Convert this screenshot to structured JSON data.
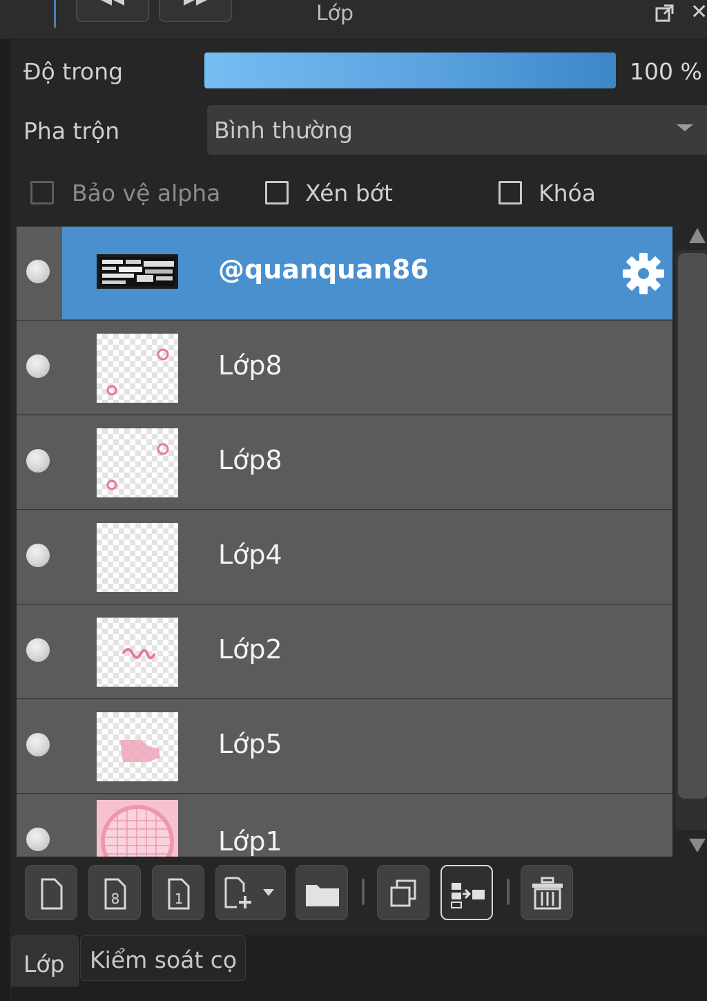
{
  "panel": {
    "title": "Lớp"
  },
  "properties": {
    "opacity_label": "Độ trong",
    "opacity_value": "100 %",
    "opacity_fraction": 1.0,
    "blend_label": "Pha trộn",
    "blend_value": "Bình thường"
  },
  "checkboxes": {
    "alpha_protect": {
      "label": "Bảo vệ alpha",
      "checked": false,
      "enabled": false
    },
    "clipping": {
      "label": "Xén bớt",
      "checked": false
    },
    "lock": {
      "label": "Khóa",
      "checked": false
    }
  },
  "layers": [
    {
      "name": "@quanquan86",
      "selected": true,
      "visible": true
    },
    {
      "name": "Lớp8",
      "selected": false,
      "visible": true
    },
    {
      "name": "Lớp8",
      "selected": false,
      "visible": true
    },
    {
      "name": "Lớp4",
      "selected": false,
      "visible": true
    },
    {
      "name": "Lớp2",
      "selected": false,
      "visible": true
    },
    {
      "name": "Lớp5",
      "selected": false,
      "visible": true
    },
    {
      "name": "Lớp1",
      "selected": false,
      "visible": true
    }
  ],
  "toolbar_icons": [
    "new-layer-icon",
    "new-8bit-layer-icon",
    "new-1bit-layer-icon",
    "add-layer-menu-icon",
    "new-folder-icon",
    "duplicate-layer-icon",
    "merge-down-icon",
    "delete-layer-icon"
  ],
  "tabs": [
    {
      "label": "Lớp",
      "active": true
    },
    {
      "label": "Kiểm soát cọ",
      "active": false
    }
  ],
  "colors": {
    "selection": "#4a90cf",
    "slider_start": "#75bdf2",
    "slider_end": "#3d86c8",
    "row_bg": "#5b5b5b",
    "thumb_pink": "#e8789a"
  }
}
